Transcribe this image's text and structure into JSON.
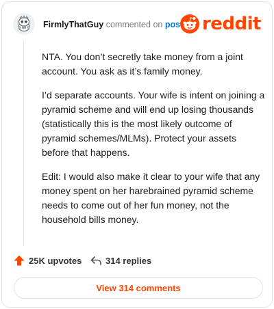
{
  "comment": {
    "username": "FirmlyThatGuy",
    "action_text": "commented on",
    "post_link": "post",
    "paragraphs": [
      "NTA. You don’t secretly take money from a joint account. You ask as it’s family money.",
      "I’d separate accounts. Your wife is intent on joining a pyramid scheme and will end up losing thousands (statistically this is the most likely outcome of pyramid schemes/MLMs). Protect your assets before that happens.",
      "Edit: I would also make it clear to your wife that any money spent on her harebrained pyramid scheme needs to come out of her fun money, not the household bills money."
    ]
  },
  "brand": {
    "logo_text": "reddit",
    "color": "#ff4500"
  },
  "footer": {
    "upvotes": "25K upvotes",
    "replies": "314 replies",
    "upvote_icon": "upvote-arrow-icon",
    "reply_icon": "reply-arrow-icon"
  },
  "view_button": {
    "label": "View 314 comments"
  }
}
